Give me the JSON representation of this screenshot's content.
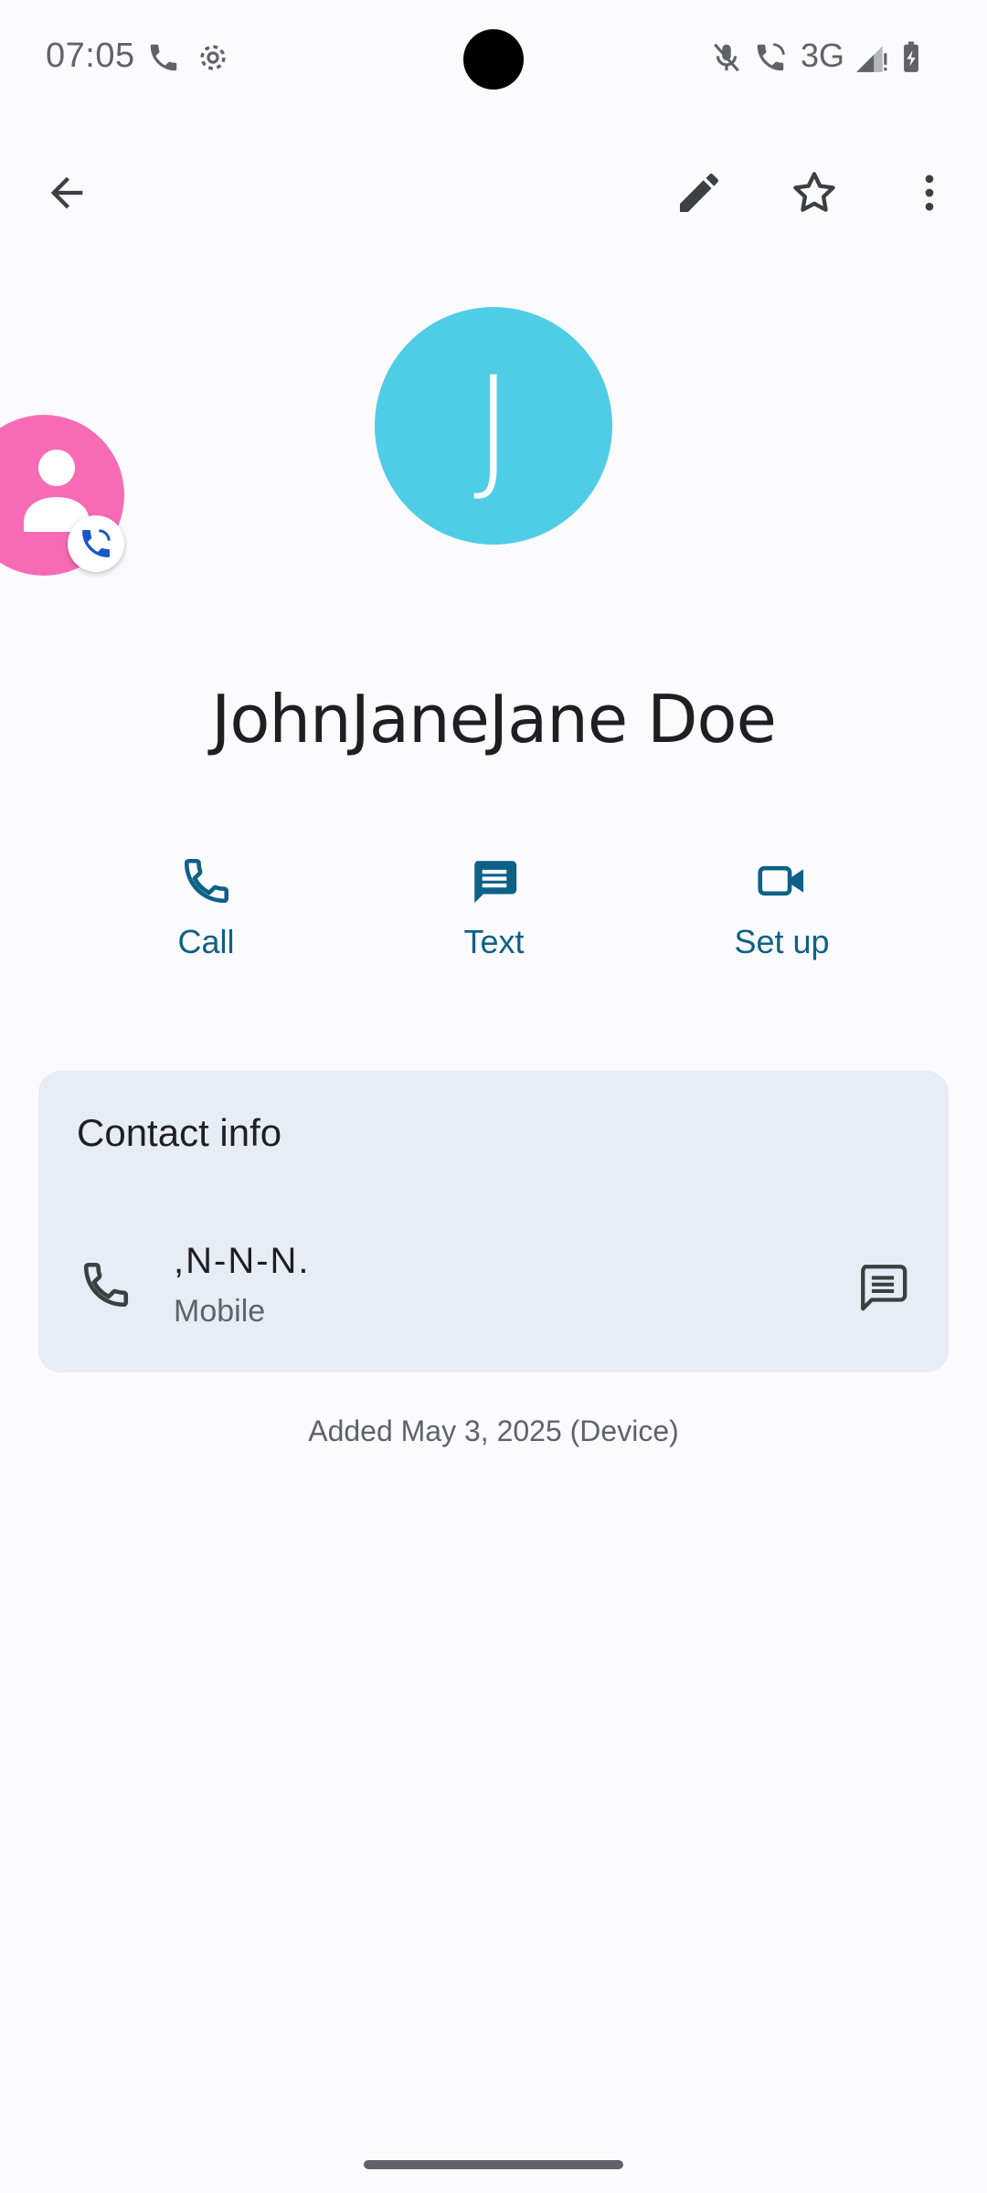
{
  "status_bar": {
    "time": "07:05",
    "left_icons": [
      "wifi-calling-icon",
      "settings-gear-icon"
    ],
    "right_icons": [
      "mic-off-icon",
      "call-icon",
      "signal-icon",
      "battery-charging-icon"
    ],
    "network": "3G"
  },
  "app_bar": {
    "icons": [
      "arrow-back-icon",
      "edit-pencil-icon",
      "star-outline-icon",
      "more-vert-icon"
    ]
  },
  "contact": {
    "avatar_letter": "J",
    "avatar_color": "#4FCDE6",
    "name": "JohnJaneJane Doe"
  },
  "floating_bubble": {
    "color": "#F76BB6",
    "icons": [
      "person-icon",
      "phone-call-icon"
    ]
  },
  "actions": [
    {
      "label": "Call",
      "icon": "phone-icon"
    },
    {
      "label": "Text",
      "icon": "message-icon"
    },
    {
      "label": "Set up",
      "icon": "video-camera-icon"
    }
  ],
  "contact_info": {
    "title": "Contact info",
    "phone": {
      "number": ",N-N-N.",
      "type": "Mobile"
    }
  },
  "added_text": "Added May 3, 2025 (Device)",
  "colors": {
    "accent": "#0D6186",
    "card_bg": "#E6EDF4",
    "background": "#FBFBFE"
  }
}
